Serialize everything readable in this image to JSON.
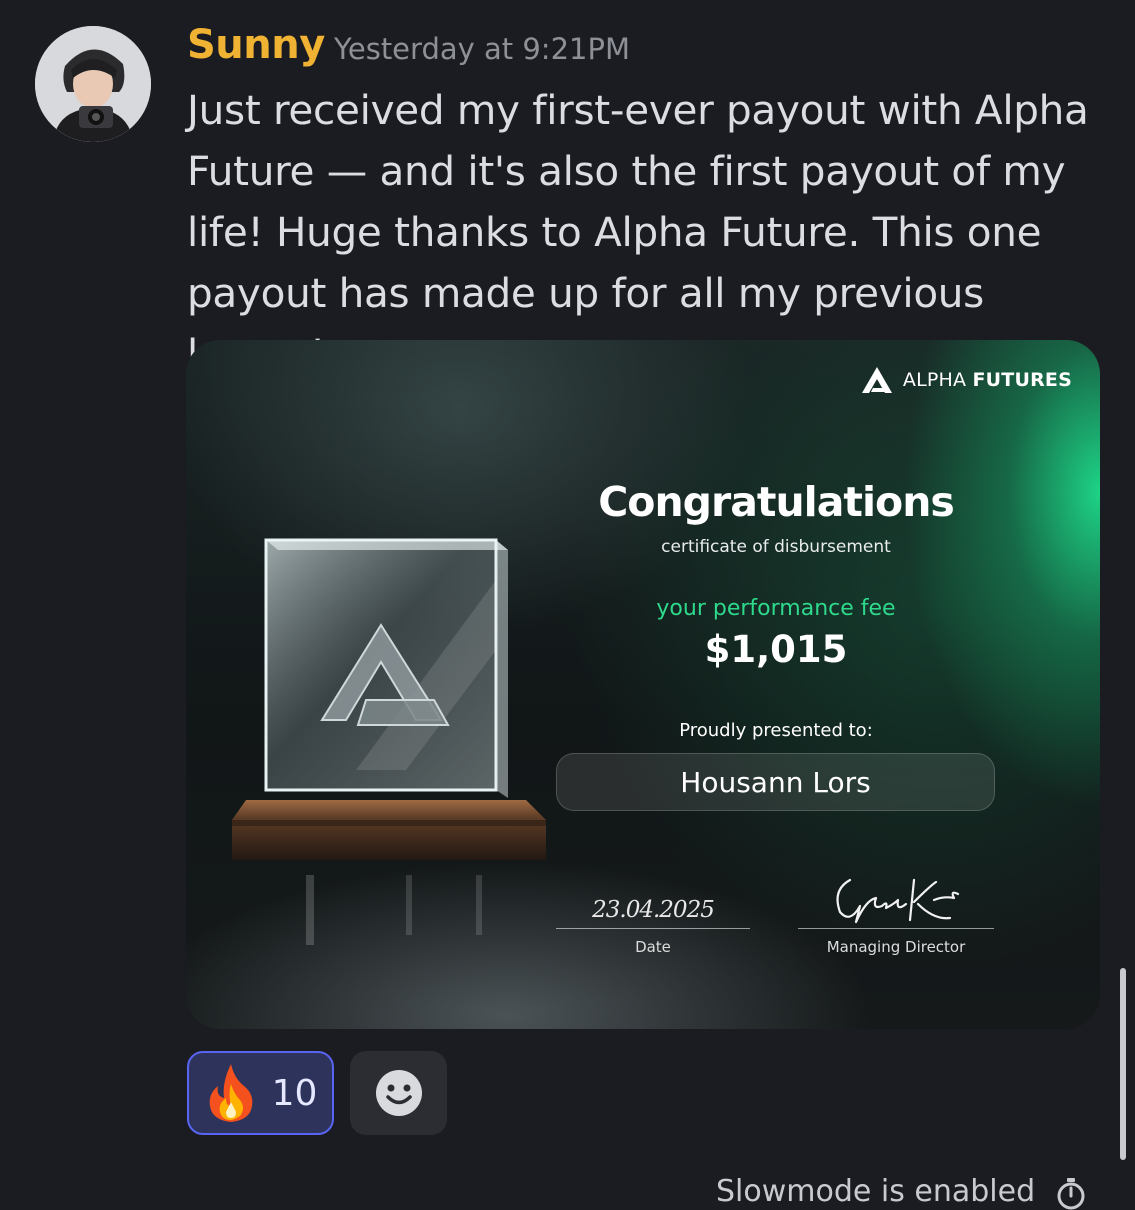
{
  "message": {
    "author": "Sunny",
    "timestamp": "Yesterday at 9:21PM",
    "text": "Just received my first-ever payout with Alpha Future — and it's also the first payout of my life! Huge thanks to Alpha Future. This one payout has made up for all my previous losses!"
  },
  "certificate": {
    "brand_light": "ALPHA",
    "brand_bold": "FUTURES",
    "title": "Congratulations",
    "subtitle": "certificate of disbursement",
    "fee_label": "your performance fee",
    "fee_amount": "$1,015",
    "presented_label": "Proudly presented to:",
    "recipient": "Housann Lors",
    "date_value": "23.04.2025",
    "date_label": "Date",
    "director_label": "Managing Director",
    "signature_text": "George Kohler"
  },
  "reactions": [
    {
      "emoji": "🔥",
      "emoji_icon": "fire-icon",
      "count": "10",
      "selected": true
    }
  ],
  "footer": {
    "slowmode_text": "Slowmode is enabled"
  },
  "colors": {
    "background": "#1b1c21",
    "author": "#f0b232",
    "accent_green": "#2ed98c",
    "reaction_border": "#5865f2"
  }
}
